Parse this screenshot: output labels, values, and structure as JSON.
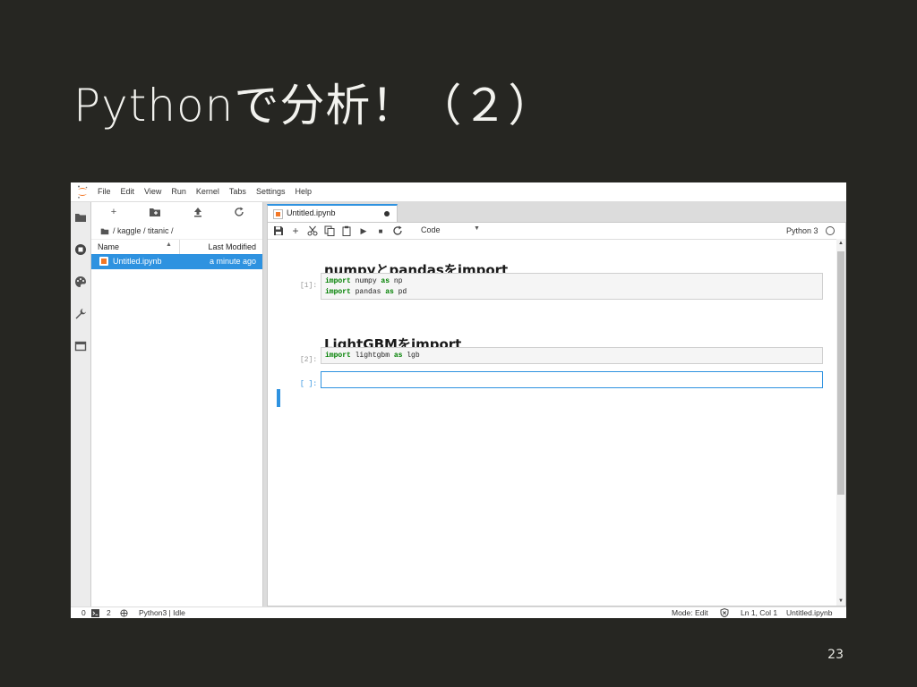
{
  "slide": {
    "title": "Pythonで分析！（２）",
    "page_number": "23"
  },
  "menubar": {
    "items": [
      "File",
      "Edit",
      "View",
      "Run",
      "Kernel",
      "Tabs",
      "Settings",
      "Help"
    ]
  },
  "left_rail": {
    "icons": [
      "folder-icon",
      "running-icon",
      "palette-icon",
      "wrench-icon",
      "tabs-icon"
    ]
  },
  "file_browser": {
    "toolbar": [
      "new-launcher-icon",
      "new-folder-icon",
      "upload-icon",
      "refresh-icon"
    ],
    "new_label": "+",
    "breadcrumb": "/ kaggle / titanic /",
    "header_name": "Name",
    "header_modified": "Last Modified",
    "files": [
      {
        "name": "Untitled.ipynb",
        "modified": "a minute ago",
        "selected": true
      }
    ]
  },
  "notebook": {
    "tab_title": "Untitled.ipynb",
    "cell_type": "Code",
    "kernel": "Python 3",
    "cells": [
      {
        "kind": "markdown",
        "text": "numpyとpandasをimport"
      },
      {
        "kind": "code",
        "prompt": "[1]:",
        "lines": [
          {
            "kw": "import",
            "mod": " numpy ",
            "as": "as",
            "alias": " np"
          },
          {
            "kw": "import",
            "mod": " pandas ",
            "as": "as",
            "alias": " pd"
          }
        ]
      },
      {
        "kind": "markdown",
        "text": "LightGBMをimport"
      },
      {
        "kind": "code",
        "prompt": "[2]:",
        "lines": [
          {
            "kw": "import",
            "mod": " lightgbm ",
            "as": "as",
            "alias": " lgb"
          }
        ]
      },
      {
        "kind": "code",
        "prompt": "[ ]:",
        "active": true,
        "lines": []
      }
    ]
  },
  "status_bar": {
    "zero": "0",
    "terminals": "2",
    "kernel_state": "Python3 | Idle",
    "mode": "Mode: Edit",
    "cursor": "Ln 1, Col 1",
    "file": "Untitled.ipynb"
  },
  "colors": {
    "accent": "#2e92e0",
    "slide_bg": "#262622",
    "keyword": "#008000"
  }
}
